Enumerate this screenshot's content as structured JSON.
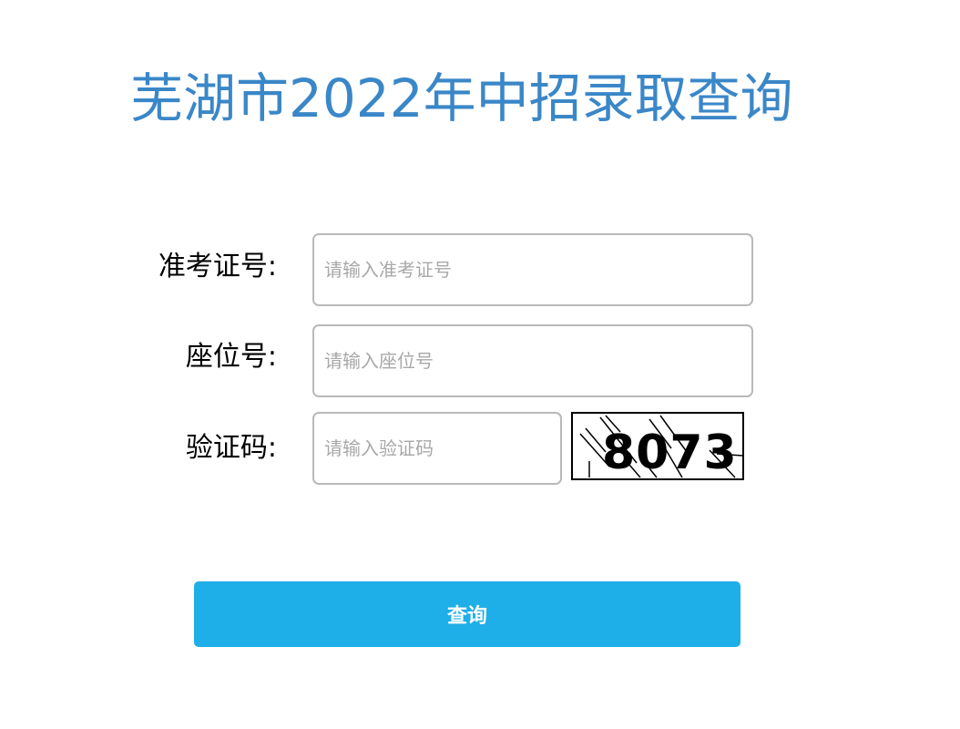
{
  "page": {
    "title": "芜湖市2022年中招录取查询"
  },
  "form": {
    "exam_id": {
      "label": "准考证号:",
      "value": "",
      "placeholder": "请输入准考证号"
    },
    "seat_no": {
      "label": "座位号:",
      "value": "",
      "placeholder": "请输入座位号"
    },
    "captcha": {
      "label": "验证码:",
      "value": "",
      "placeholder": "请输入验证码",
      "image_text": "8073"
    },
    "submit_label": "查询"
  },
  "colors": {
    "title": "#3a87c8",
    "button": "#1fafe8",
    "input_border": "#b9b9b9",
    "placeholder": "#a8a8a8"
  }
}
